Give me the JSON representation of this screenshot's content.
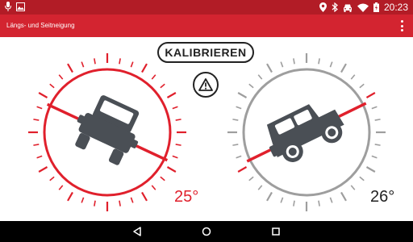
{
  "status_bar": {
    "time": "20:23",
    "left_icons": [
      "mic-icon",
      "image-icon"
    ],
    "right_icons": [
      "location-icon",
      "bluetooth-icon",
      "car-icon",
      "wifi-icon",
      "battery-icon"
    ]
  },
  "app_bar": {
    "title": "Längs- und Seitneigung",
    "menu_icon": "more-vert-icon"
  },
  "actions": {
    "calibrate_label": "KALIBRIEREN",
    "warning_icon": "warning-icon"
  },
  "gauges": {
    "roll": {
      "angle_label": "25°",
      "angle_value": 25,
      "color": "#e0202c",
      "status": "warning",
      "vehicle_view": "front"
    },
    "pitch": {
      "angle_label": "26°",
      "angle_value": 26,
      "color": "#9e9e9e",
      "indicator_color": "#e0202c",
      "status": "normal",
      "vehicle_view": "side"
    }
  },
  "colors": {
    "status_bar": "#b21c26",
    "app_bar": "#d32430",
    "accent_red": "#e0202c",
    "neutral_gray": "#9e9e9e",
    "vehicle": "#4a4f55"
  },
  "nav_bar": {
    "buttons": [
      "back-icon",
      "home-icon",
      "recents-icon"
    ]
  }
}
